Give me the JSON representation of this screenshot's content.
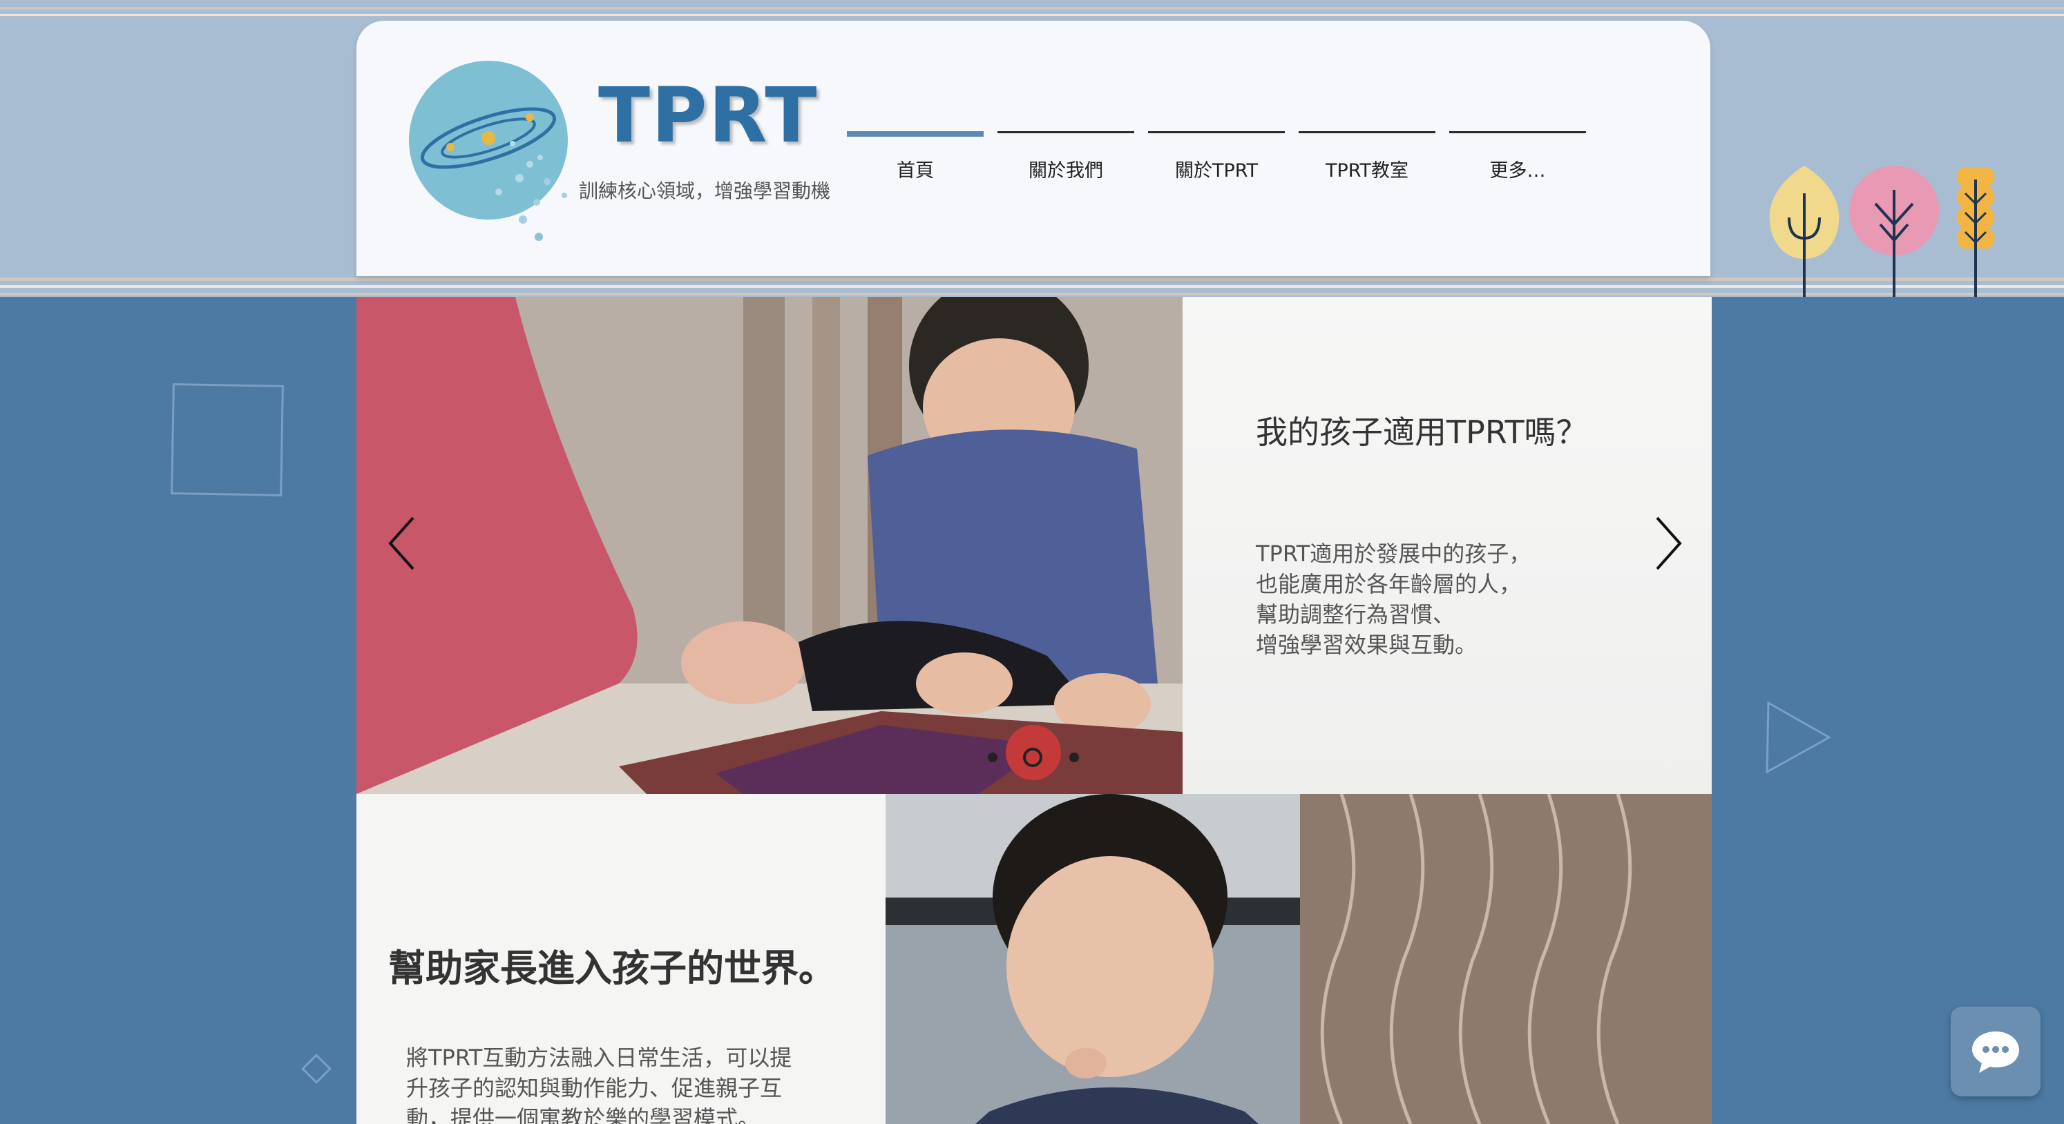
{
  "brand": {
    "logo_text": "TPRT",
    "tagline": "訓練核心領域，增強學習動機"
  },
  "nav": {
    "items": [
      {
        "label": "首頁",
        "active": true
      },
      {
        "label": "關於我們",
        "active": false
      },
      {
        "label": "關於TPRT",
        "active": false
      },
      {
        "label": "TPRT教室",
        "active": false
      },
      {
        "label": "更多…",
        "active": false
      }
    ]
  },
  "slideshow": {
    "title": "我的孩子適用TPRT嗎？",
    "body_lines": [
      "TPRT適用於發展中的孩子，",
      "也能廣用於各年齡層的人，",
      "幫助調整行為習慣、",
      "增強學習效果與互動。"
    ],
    "slide_count": 3,
    "current_slide_index": 1
  },
  "section2": {
    "title": "幫助家長進入孩子的世界。",
    "body_lines": [
      "將TPRT互動方法融入日常生活，可以提",
      "升孩子的認知與動作能力、促進親子互",
      "動，提供一個寓教於樂的學習模式。"
    ]
  },
  "colors": {
    "page_background": "#4d7aa3",
    "top_band": "#a9bdd2",
    "brand_blue": "#2e6fa4",
    "nav_active": "#5a8ab3",
    "tree_yellow": "#f0d98a",
    "tree_pink": "#e899b4",
    "tree_orange": "#f2b544"
  },
  "icons": {
    "prev": "chevron-left-icon",
    "next": "chevron-right-icon",
    "chat": "chat-bubble-icon"
  }
}
